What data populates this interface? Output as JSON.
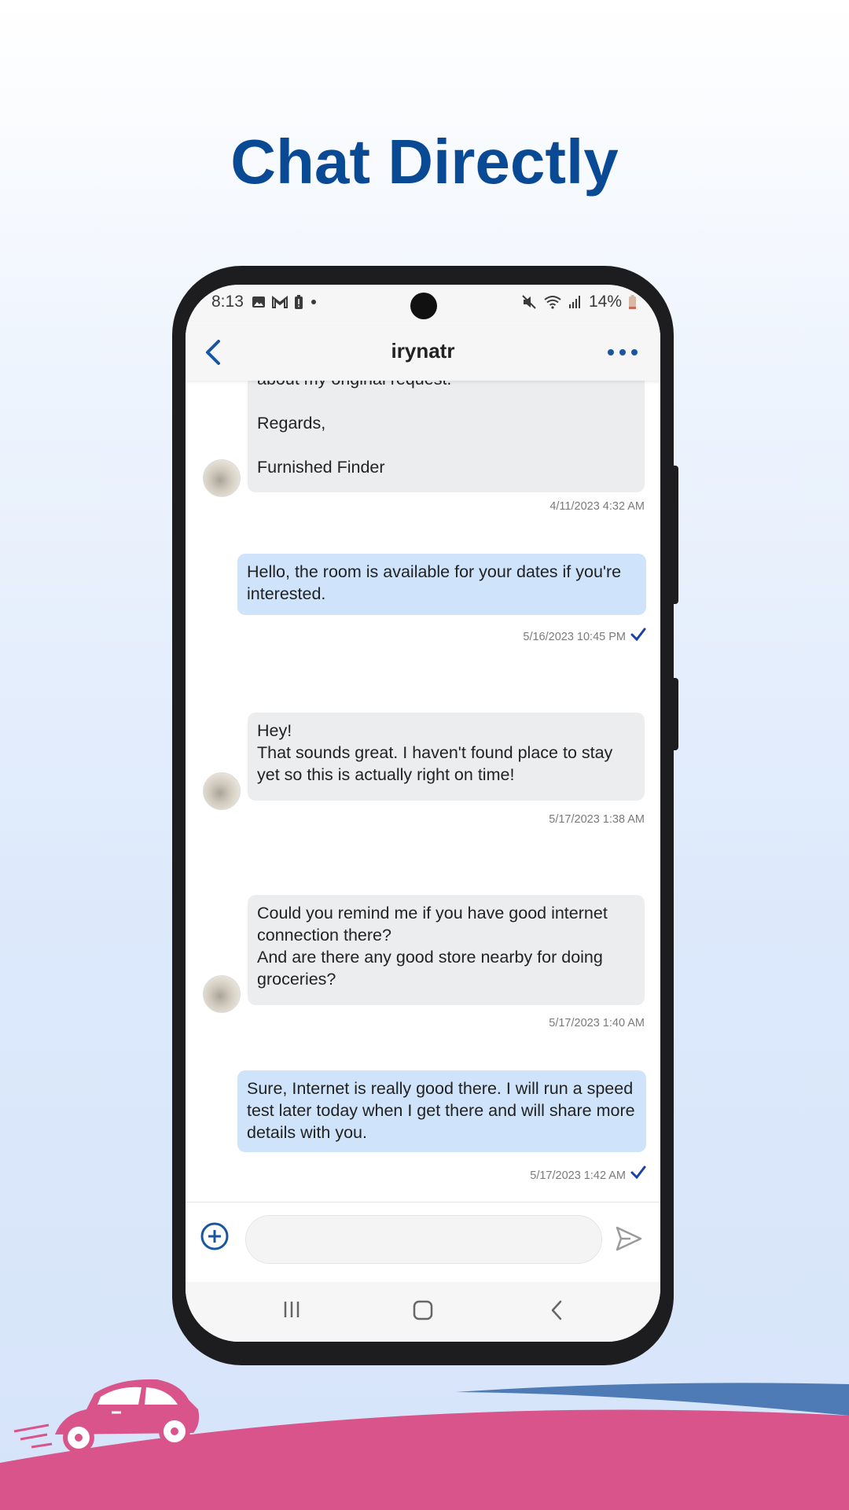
{
  "headline": "Chat Directly",
  "status_bar": {
    "time": "8:13",
    "battery": "14%"
  },
  "header": {
    "title": "irynatr"
  },
  "messages": [
    {
      "direction": "incoming",
      "text": "about my original request.\n\nRegards,\n\nFurnished Finder",
      "timestamp": "4/11/2023 4:32 AM"
    },
    {
      "direction": "outgoing",
      "text": "Hello, the room is available for your dates if you're interested.",
      "timestamp": "5/16/2023 10:45 PM",
      "read": true
    },
    {
      "direction": "incoming",
      "text": "Hey!\nThat sounds great. I haven't found place to stay yet so this is actually right on time!",
      "timestamp": "5/17/2023 1:38 AM"
    },
    {
      "direction": "incoming",
      "text": "Could you remind me if you have good internet connection there?\nAnd are there any good store nearby for doing groceries?",
      "timestamp": "5/17/2023 1:40 AM"
    },
    {
      "direction": "outgoing",
      "text": "Sure, Internet is really good there. I will run a speed test later today when I get there and will share more details with you.",
      "timestamp": "5/17/2023 1:42 AM",
      "read": true
    }
  ],
  "composer": {
    "placeholder": ""
  },
  "colors": {
    "headline": "#0a4a94",
    "accent": "#1a56a0",
    "outgoing_bubble": "#cfe3fb",
    "incoming_bubble": "#ecedef",
    "road_pink": "#d9548a",
    "road_blue": "#4e7bb5"
  },
  "icons": {
    "back": "chevron-left-icon",
    "more": "more-horizontal-icon",
    "attach": "plus-circle-icon",
    "send": "send-icon",
    "read": "check-icon"
  }
}
